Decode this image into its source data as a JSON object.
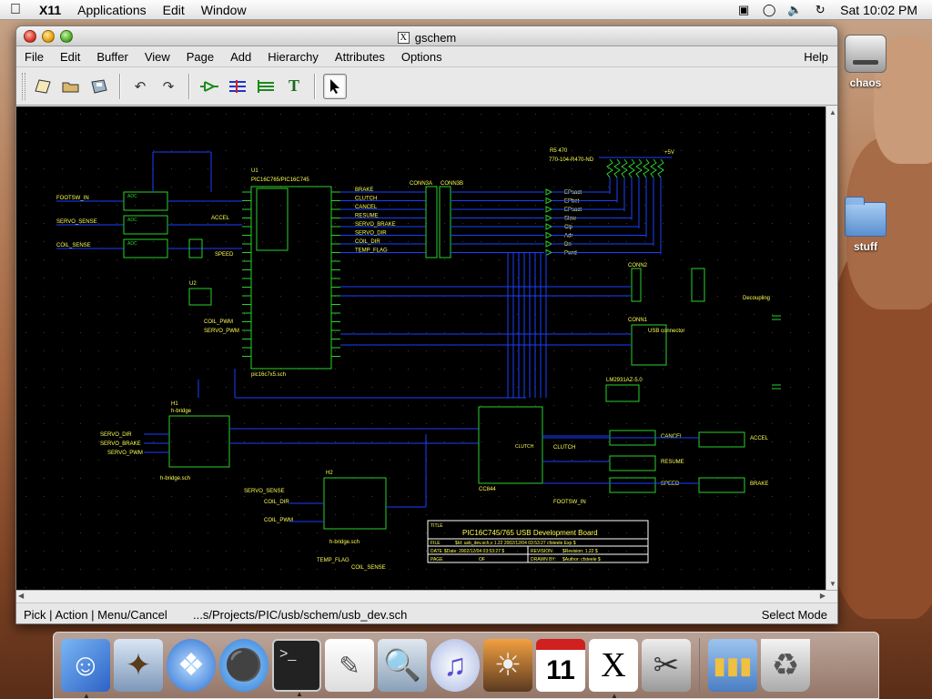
{
  "menubar": {
    "app": "X11",
    "items": [
      "Applications",
      "Edit",
      "Window"
    ],
    "clock": "Sat 10:02 PM"
  },
  "desktop": {
    "icons": [
      "chaos",
      "stuff"
    ]
  },
  "window": {
    "title": "gschem",
    "menu": [
      "File",
      "Edit",
      "Buffer",
      "View",
      "Page",
      "Add",
      "Hierarchy",
      "Attributes",
      "Options"
    ],
    "help": "Help",
    "toolbar": [
      "new-page-icon",
      "open-icon",
      "save-icon",
      "undo-icon",
      "redo-icon",
      "add-component-icon",
      "add-net-icon",
      "add-bus-icon",
      "add-text-icon",
      "select-arrow-icon"
    ]
  },
  "schematic": {
    "colors": {
      "background": "#000000",
      "nets": "#1a3fff",
      "components": "#2bd12b",
      "text": "#ffff55",
      "title_box": "#ffffff"
    },
    "title_block": {
      "title_label": "TITLE",
      "title": "PIC16C745/765 USB Development Board",
      "file_label": "FILE",
      "file": "$Id: usb_dev.sch,v 1.22 2002/12/04 03:53:27 cfsteele Exp $",
      "date_label": "DATE",
      "date": "$Date: 2002/12/04 03:53:27 $",
      "revision_label": "REVISION",
      "revision": "$Revision: 1.22 $",
      "page_label": "PAGE",
      "of_label": "OF",
      "drawn_label": "DRAWN BY:",
      "drawn": "$Author: cfsteele $"
    },
    "labels": {
      "u1": "U1",
      "u1_part": "PIC16C765/PIC16C745",
      "u1_file": "pic16c7x5.sch",
      "u2": "U2",
      "u3": "U3",
      "u4": "U4",
      "u5": "U5",
      "r5": "R5  470",
      "rn_part": "770-104-R470-ND",
      "brake": "BRAKE",
      "clutch": "CLUTCH",
      "cancel": "CANCEL",
      "resume": "RESUME",
      "servo_brake": "SERVO_BRAKE",
      "servo_dir": "SERVO_DIR",
      "coil_dir": "COIL_DIR",
      "temp_flag": "TEMP_FLAG",
      "footsw": "FOOTSW_IN",
      "servo_sense": "SERVO_SENSE",
      "coil_sense": "COIL_SENSE",
      "accel": "ACCEL",
      "speed": "SPEED",
      "coil_pwm": "COIL_PWM",
      "servo_pwm": "SERVO_PWM",
      "conn1": "CONN1",
      "conn2": "CONN2",
      "conn3a": "CONN3A",
      "conn3b": "CONN3B",
      "usb_conn": "USB connector",
      "hbridge": "h-bridge",
      "hbridge_file": "h-bridge.sch",
      "cc844": "CC844",
      "decoupling": "Decoupling",
      "vcc": "+5V",
      "ldo": "LM2931AZ-5.0",
      "h1": "H1",
      "h2": "H2",
      "led_labels": [
        "EPsact",
        "EPbet",
        "EPsact",
        "Slow",
        "Clp",
        "Adr",
        "Dn",
        "Pwrd"
      ]
    }
  },
  "status": {
    "left": "Pick | Action | Menu/Cancel",
    "path": "...s/Projects/PIC/usb/schem/usb_dev.sch",
    "mode": "Select Mode"
  },
  "dock": {
    "items": [
      "finder-icon",
      "mail-icon",
      "safari-icon",
      "ichat-icon",
      "terminal-icon",
      "textedit-icon",
      "preview-icon",
      "itunes-icon",
      "iphoto-icon",
      "ical-icon",
      "x11-icon",
      "grab-icon",
      "applications-folder-icon",
      "trash-icon"
    ]
  }
}
